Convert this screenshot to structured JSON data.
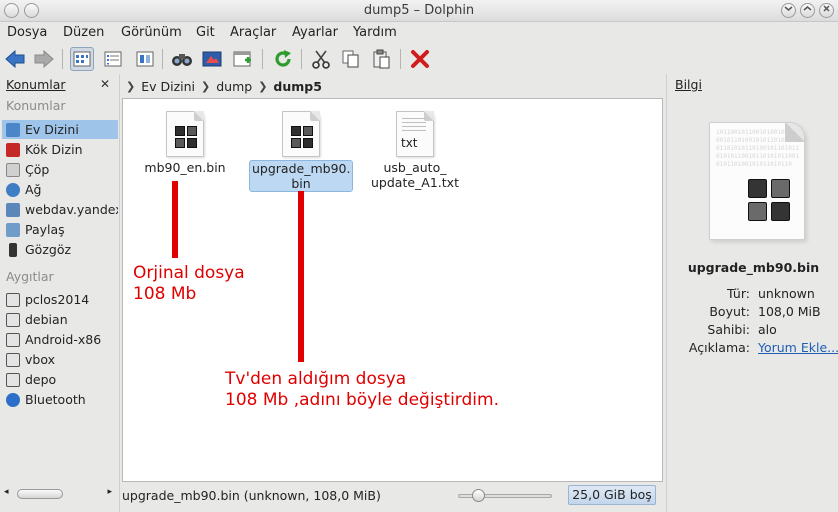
{
  "window": {
    "title": "dump5 – Dolphin"
  },
  "menubar": {
    "items": [
      {
        "label": "Dosya"
      },
      {
        "label": "Düzen"
      },
      {
        "label": "Görünüm"
      },
      {
        "label": "Git"
      },
      {
        "label": "Araçlar"
      },
      {
        "label": "Ayarlar"
      },
      {
        "label": "Yardım"
      }
    ]
  },
  "toolbar": {
    "icons": [
      "back-arrow-icon",
      "forward-arrow-icon",
      "icons-view-icon",
      "details-view-icon",
      "split-view-icon",
      "find-icon",
      "preview-icon",
      "new-folder-icon",
      "refresh-icon",
      "cut-icon",
      "copy-icon",
      "paste-icon",
      "delete-icon"
    ]
  },
  "places": {
    "header": "Konumlar",
    "section_places": "Konumlar",
    "items": [
      {
        "label": "Ev Dizini",
        "icon": "home-icon",
        "color": "#4a86c8"
      },
      {
        "label": "Kök Dizin",
        "icon": "root-folder-icon",
        "color": "#c62828"
      },
      {
        "label": "Çöp",
        "icon": "trash-icon",
        "color": "#9e9e9e"
      },
      {
        "label": "Ağ",
        "icon": "network-icon",
        "color": "#3f7dc4"
      },
      {
        "label": "webdav.yandex",
        "icon": "network-folder-icon",
        "color": "#5b88b8"
      },
      {
        "label": "Paylaş",
        "icon": "share-folder-icon",
        "color": "#6f9cc9"
      },
      {
        "label": "Gözgöz",
        "icon": "phone-icon",
        "color": "#333333"
      }
    ],
    "section_devices": "Aygıtlar",
    "devices": [
      {
        "label": "pclos2014",
        "icon": "drive-icon"
      },
      {
        "label": "debian",
        "icon": "drive-icon"
      },
      {
        "label": "Android-x86",
        "icon": "drive-icon"
      },
      {
        "label": "vbox",
        "icon": "drive-icon"
      },
      {
        "label": "depo",
        "icon": "drive-icon"
      },
      {
        "label": "Bluetooth",
        "icon": "bluetooth-icon"
      }
    ]
  },
  "breadcrumb": {
    "parts": [
      "Ev Dizini",
      "dump",
      "dump5"
    ]
  },
  "files": [
    {
      "name": "mb90_en.bin",
      "type": "binary"
    },
    {
      "name": "upgrade_mb90.\nbin",
      "type": "binary"
    },
    {
      "name": "usb_auto_\nupdate_A1.txt",
      "type": "txt",
      "tag": "txt"
    }
  ],
  "annotations": {
    "first": [
      "Orjinal dosya",
      "108 Mb"
    ],
    "second": [
      "Tv'den aldığım dosya",
      "108 Mb ,adını böyle değiştirdim."
    ]
  },
  "statusbar": {
    "text": "upgrade_mb90.bin (unknown, 108,0 MiB)",
    "free_space": "25,0 GiB boş",
    "zoom_fraction": 0.18
  },
  "info": {
    "header": "Bilgi",
    "binary_pattern": "10110010110010100101101001011010010101101001010110101011010010110101101010110010110101011001010110100101011010110",
    "file_name": "upgrade_mb90.bin",
    "fields": [
      {
        "key": "Tür:",
        "value": "unknown"
      },
      {
        "key": "Boyut:",
        "value": "108,0 MiB"
      },
      {
        "key": "Sahibi:",
        "value": "alo"
      },
      {
        "key": "Açıklama:",
        "value": "Yorum Ekle..."
      }
    ]
  }
}
